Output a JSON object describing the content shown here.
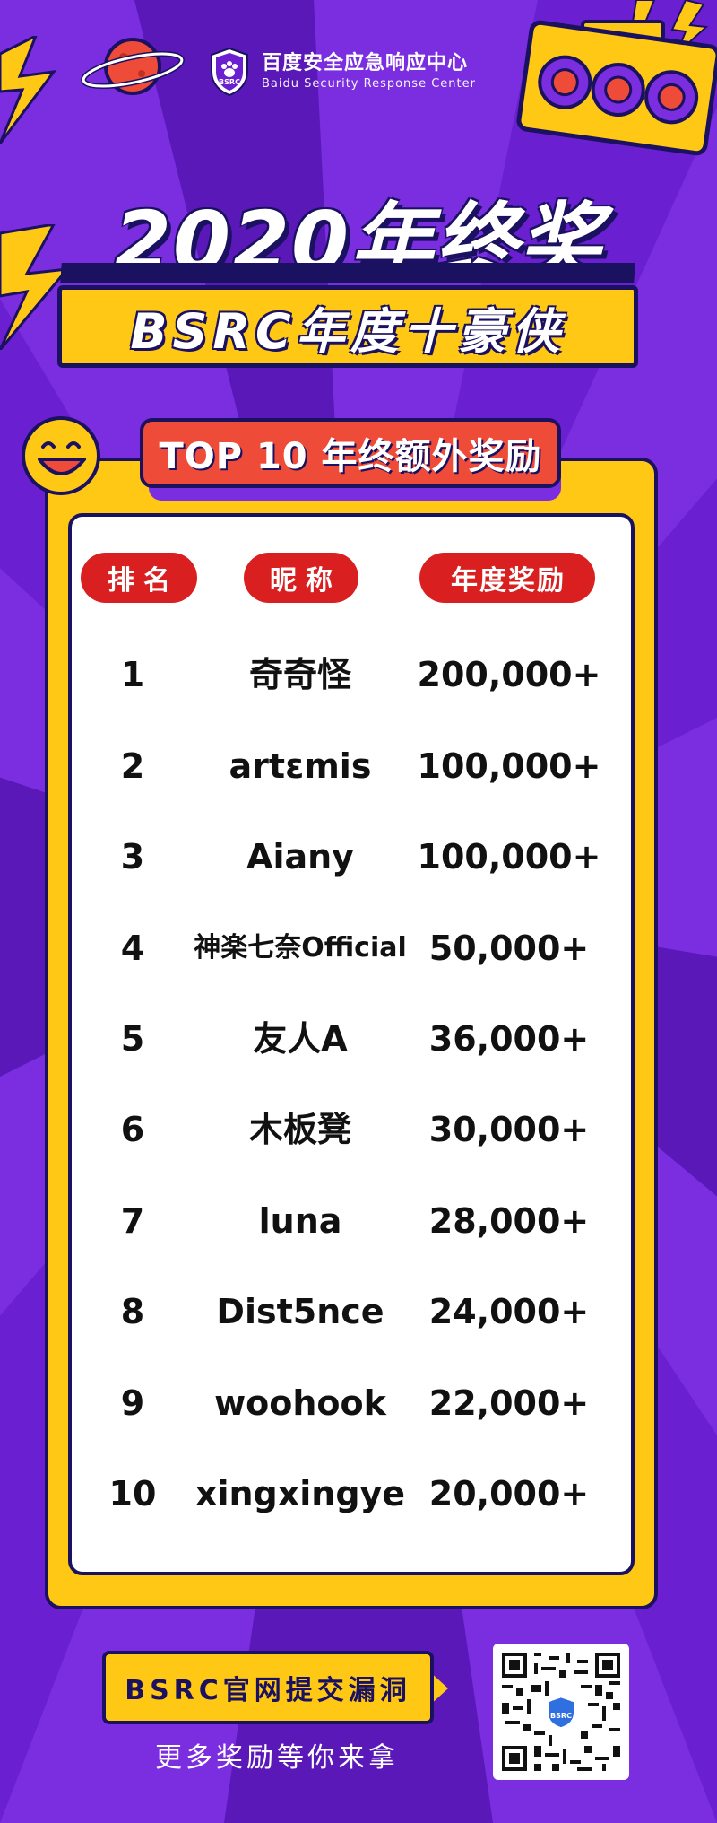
{
  "header": {
    "brand_cn": "百度安全应急响应中心",
    "brand_en": "Baidu Security Response Center",
    "brand_badge": "BSRC"
  },
  "titles": {
    "main": "2020年终奖",
    "sub": "BSRC年度十豪侠",
    "top_banner": "TOP 10 年终额外奖励"
  },
  "table": {
    "headers": [
      "排名",
      "昵称",
      "年度奖励"
    ],
    "rows": [
      {
        "rank": "1",
        "name": "奇奇怪",
        "prize": "200,000+"
      },
      {
        "rank": "2",
        "name": "artɛmis",
        "prize": "100,000+"
      },
      {
        "rank": "3",
        "name": "Aiany",
        "prize": "100,000+"
      },
      {
        "rank": "4",
        "name": "神楽七奈Official",
        "prize": "50,000+"
      },
      {
        "rank": "5",
        "name": "友人A",
        "prize": "36,000+"
      },
      {
        "rank": "6",
        "name": "木板凳",
        "prize": "30,000+"
      },
      {
        "rank": "7",
        "name": "luna",
        "prize": "28,000+"
      },
      {
        "rank": "8",
        "name": "Dist5nce",
        "prize": "24,000+"
      },
      {
        "rank": "9",
        "name": "woohook",
        "prize": "22,000+"
      },
      {
        "rank": "10",
        "name": "xingxingye",
        "prize": "20,000+"
      }
    ]
  },
  "footer": {
    "cta": "BSRC官网提交漏洞",
    "sub": "更多奖励等你来拿",
    "qr_badge": "BSRC"
  },
  "colors": {
    "background": "#6a1fd1",
    "yellow": "#ffc814",
    "navy": "#1a1160",
    "red": "#d91f1f",
    "coral": "#ee4b39"
  }
}
